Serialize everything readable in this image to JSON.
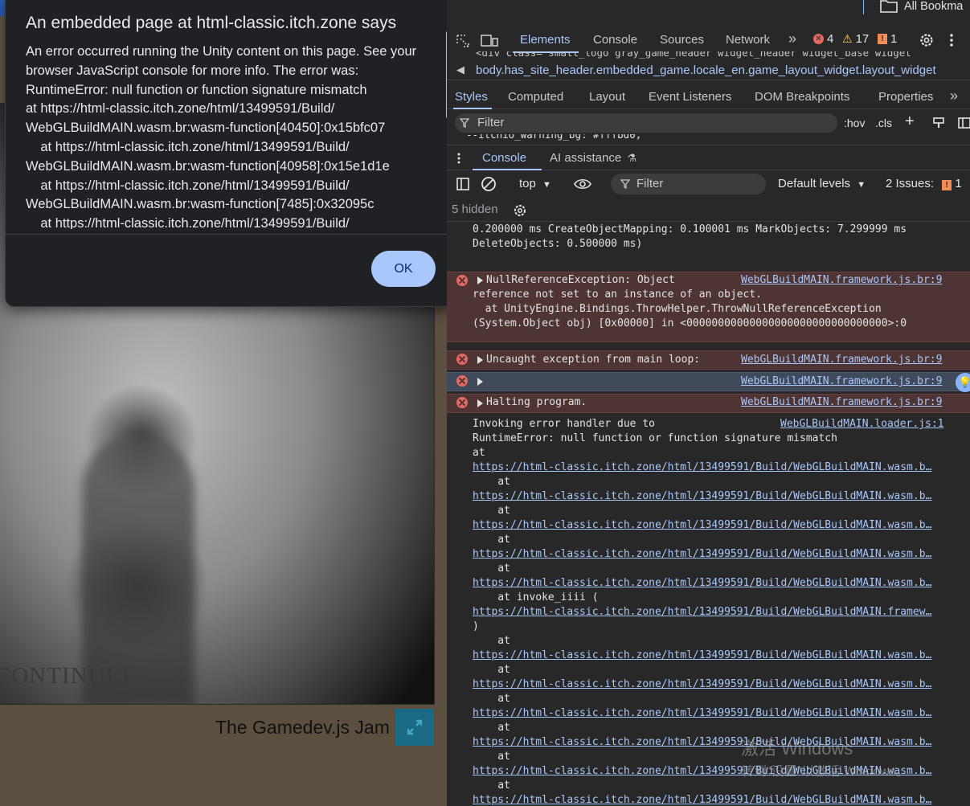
{
  "bookmarks": {
    "all_bookmarks": "All Bookma"
  },
  "devtools": {
    "tabs": [
      "Elements",
      "Console",
      "Sources",
      "Network"
    ],
    "overflow": "»",
    "counts": {
      "errors": "4",
      "warnings": "17",
      "issues": "1"
    },
    "dom_line": "<div class=\"small_logo gray_game_header widget_header widget_base widget",
    "breadcrumb": "body.has_site_header.embedded_game.locale_en.game_layout_widget.layout_widget",
    "styles_tabs": [
      "Styles",
      "Computed",
      "Layout",
      "Event Listeners",
      "DOM Breakpoints",
      "Properties"
    ],
    "styles_filter_placeholder": "Filter",
    "hov": ":hov",
    "cls": ".cls",
    "peek_line": "--itchio_warning_bg: #fffbd0;",
    "drawer": {
      "console": "Console",
      "ai": "AI assistance"
    },
    "console_toolbar": {
      "context": "top",
      "filter_placeholder": "Filter",
      "levels": "Default levels",
      "issues": "2 Issues:",
      "issues_count": "1",
      "hidden": "5 hidden"
    },
    "log": {
      "timing_line1": "0.200000 ms CreateObjectMapping: 0.100001 ms MarkObjects: 7.299999 ms",
      "timing_line2": "DeleteObjects: 0.500000 ms)",
      "nre_line1": "NullReferenceException: Object",
      "nre_line2": "reference not set to an instance of an object.",
      "nre_line3": "  at UnityEngine.Bindings.ThrowHelper.ThrowNullReferenceException",
      "nre_line4": "(System.Object obj) [0x00000] in <00000000000000000000000000000000>:0",
      "uncaught": "Uncaught exception from main loop:",
      "halting": "Halting program.",
      "src_framework": "WebGLBuildMAIN.framework.js.br:9",
      "src_loader": "WebGLBuildMAIN.loader.js:1",
      "invoking_1": "Invoking error handler due to",
      "invoking_2": "RuntimeError: null function or function signature mismatch",
      "at": "at",
      "at_indent": "    at",
      "invoke_line": "    at invoke_iiii (",
      "close_paren": ")",
      "wasm_link": "https://html-classic.itch.zone/html/13499591/Build/WebGLBuildMAIN.wasm.b…",
      "framework_link": "https://html-classic.itch.zone/html/13499591/Build/WebGLBuildMAIN.framew…"
    },
    "watermark": {
      "line1": "激活 Windows",
      "line2": "转到\"设置\"以激活 Windows。"
    }
  },
  "dialog": {
    "title": "An embedded page at html-classic.itch.zone says",
    "message": "An error occurred running the Unity content on this page. See your browser JavaScript console for more info. The error was:\nRuntimeError: null function or function signature mismatch\nat https://html-classic.itch.zone/html/13499591/Build/\nWebGLBuildMAIN.wasm.br:wasm-function[40450]:0x15bfc07\n    at https://html-classic.itch.zone/html/13499591/Build/\nWebGLBuildMAIN.wasm.br:wasm-function[40958]:0x15e1d1e\n    at https://html-classic.itch.zone/html/13499591/Build/\nWebGLBuildMAIN.wasm.br:wasm-function[7485]:0x32095c\n    at https://html-classic.itch.zone/html/13499591/Build/",
    "ok": "OK"
  },
  "game": {
    "continue_text": "CONTINUE)",
    "jam_title": "The Gamedev.js Jam"
  },
  "colors": {
    "accent": "#a8c7fa",
    "error_bg": "#4e3534",
    "error_icon": "#e46962",
    "warning": "#fdd663"
  }
}
